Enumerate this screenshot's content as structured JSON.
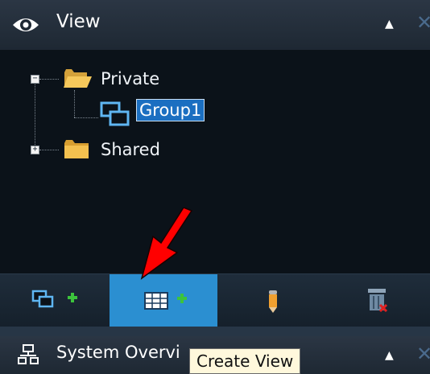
{
  "view_panel": {
    "title": "View",
    "icon": "eye-icon",
    "collapse_glyph": "▲",
    "close_glyph": "✕"
  },
  "tree": {
    "nodes": [
      {
        "label": "Private",
        "icon": "folder-open-icon",
        "expander": "−",
        "expanded": true,
        "children": [
          {
            "label": "Group1",
            "icon": "group-icon",
            "selected": true
          }
        ]
      },
      {
        "label": "Shared",
        "icon": "folder-icon",
        "expander": "+",
        "expanded": false
      }
    ]
  },
  "toolbar": {
    "buttons": [
      {
        "name": "add-group",
        "icon": "add-group-icon"
      },
      {
        "name": "create-view",
        "icon": "create-view-icon",
        "active": true
      },
      {
        "name": "rename",
        "icon": "pencil-icon"
      },
      {
        "name": "delete",
        "icon": "delete-icon"
      }
    ],
    "accent_color": "#2b8fd1"
  },
  "system_panel": {
    "title": "System Overvi",
    "icon": "network-icon",
    "collapse_glyph": "▲",
    "close_glyph": "✕"
  },
  "tooltip": {
    "text": "Create View"
  },
  "annotation": {
    "icon": "red-arrow-icon",
    "color": "#ff0000"
  }
}
